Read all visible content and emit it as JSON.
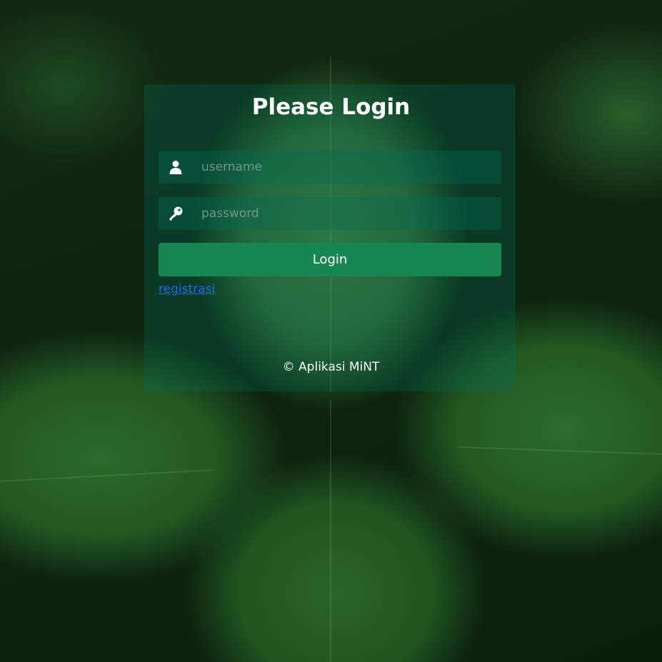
{
  "login": {
    "title": "Please Login",
    "username": {
      "icon": "user-icon",
      "placeholder": "username",
      "value": ""
    },
    "password": {
      "icon": "key-icon",
      "placeholder": "password",
      "value": ""
    },
    "submit_label": "Login",
    "register_label": "registrasi",
    "footer": "© Aplikasi MiNT"
  },
  "colors": {
    "button": "#188651",
    "link": "#1e6cf0",
    "card": "rgba(0,110,90,0.28)",
    "text": "#ffffff"
  }
}
